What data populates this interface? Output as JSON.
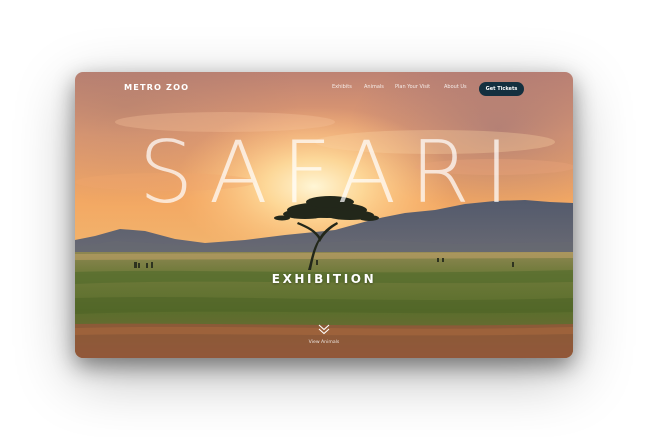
{
  "header": {
    "logo": "METRO ZOO",
    "nav": [
      {
        "label": "Exhibits"
      },
      {
        "label": "Animals"
      },
      {
        "label": "Plan Your Visit"
      },
      {
        "label": "About Us"
      }
    ],
    "cta_label": "Get Tickets"
  },
  "hero": {
    "title": "SAFARI",
    "subtitle": "EXHIBITION",
    "scroll_label": "View Animals",
    "scroll_icon": "chevron-down-icon",
    "background": "savanna sunset with acacia tree"
  },
  "colors": {
    "cta_background": "#14303f",
    "text": "#ffffff",
    "sky_top": "#c98a6e",
    "sky_glow": "#ffe7b0",
    "mountains": "#4b5666",
    "grass": "#5a6a2a",
    "soil": "#9a5a3a"
  }
}
